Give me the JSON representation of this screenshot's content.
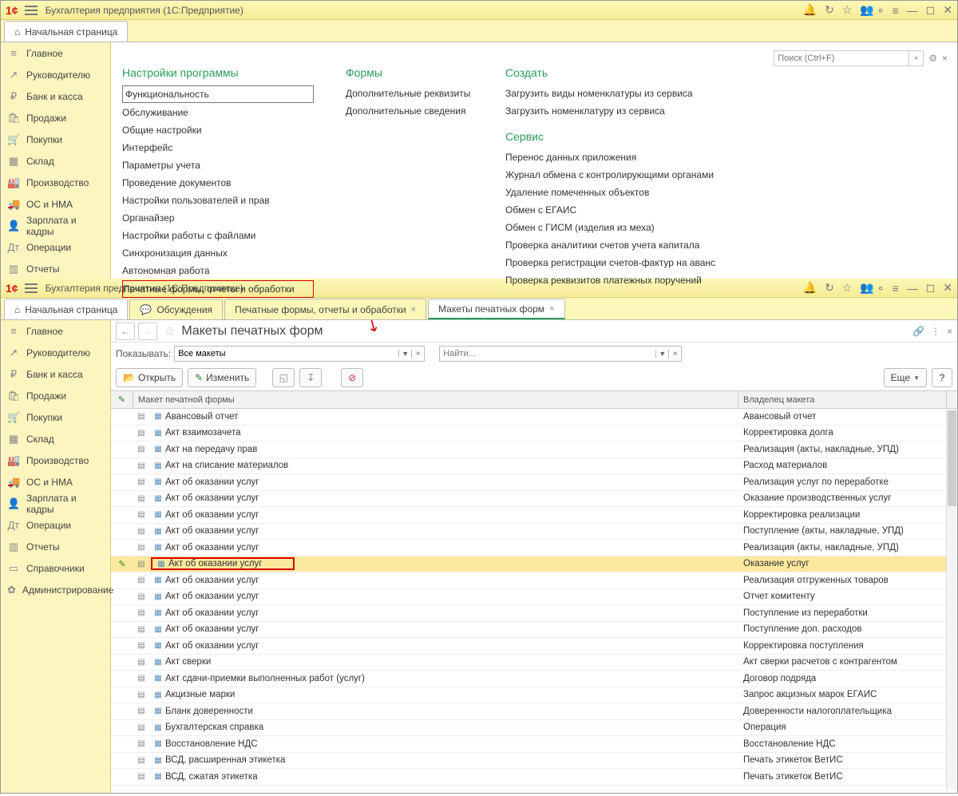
{
  "app": {
    "title": "Бухгалтерия предприятия  (1С:Предприятие)"
  },
  "search": {
    "placeholder": "Поиск (Ctrl+F)"
  },
  "tabs_top": {
    "home": "Начальная страница"
  },
  "sidebar": {
    "items": [
      {
        "label": "Главное",
        "icon": "≡"
      },
      {
        "label": "Руководителю",
        "icon": "↗"
      },
      {
        "label": "Банк и касса",
        "icon": "₽"
      },
      {
        "label": "Продажи",
        "icon": "🛍"
      },
      {
        "label": "Покупки",
        "icon": "🛒"
      },
      {
        "label": "Склад",
        "icon": "▦"
      },
      {
        "label": "Производство",
        "icon": "🏭"
      },
      {
        "label": "ОС и НМА",
        "icon": "🚚"
      },
      {
        "label": "Зарплата и кадры",
        "icon": "👤"
      },
      {
        "label": "Операции",
        "icon": "Дт"
      },
      {
        "label": "Отчеты",
        "icon": "▥"
      }
    ]
  },
  "sidebar2_extra": [
    {
      "label": "Справочники",
      "icon": "▭"
    },
    {
      "label": "Администрирование",
      "icon": "✿"
    }
  ],
  "settings": {
    "col1": {
      "h": "Настройки программы",
      "items": [
        "Функциональность",
        "Обслуживание",
        "Общие настройки",
        "Интерфейс",
        "Параметры учета",
        "Проведение документов",
        "Настройки пользователей и прав",
        "Органайзер",
        "Настройки работы с файлами",
        "Синхронизация данных",
        "Автономная работа",
        "Печатные формы, отчеты и обработки"
      ]
    },
    "col2": {
      "h": "Формы",
      "items": [
        "Дополнительные реквизиты",
        "Дополнительные сведения"
      ]
    },
    "col3": {
      "h": "Создать",
      "items": [
        "Загрузить виды номенклатуры из сервиса",
        "Загрузить номенклатуру из сервиса"
      ]
    },
    "col4": {
      "h": "Сервис",
      "items": [
        "Перенос данных приложения",
        "Журнал обмена с контролирующими органами",
        "Удаление помеченных объектов",
        "Обмен с ЕГАИС",
        "Обмен с ГИСМ (изделия из меха)",
        "Проверка аналитики счетов учета капитала",
        "Проверка регистрации счетов-фактур на аванс",
        "Проверка реквизитов платежных поручений"
      ]
    }
  },
  "tabs2": [
    {
      "label": "Начальная страница",
      "home": true
    },
    {
      "label": "Обсуждения",
      "icon": "💬",
      "close": false
    },
    {
      "label": "Печатные формы, отчеты и обработки",
      "close": true
    },
    {
      "label": "Макеты печатных форм",
      "close": true,
      "active": true
    }
  ],
  "page2": {
    "title": "Макеты печатных форм",
    "filter_lbl": "Показывать:",
    "filter_val": "Все макеты",
    "find_ph": "Найти...",
    "btn_open": "Открыть",
    "btn_edit": "Изменить",
    "btn_more": "Еще",
    "head1": "Макет печатной формы",
    "head2": "Владелец макета"
  },
  "rows": [
    {
      "n": "Авансовый отчет",
      "o": "Авансовый отчет"
    },
    {
      "n": "Акт взаимозачета",
      "o": "Корректировка долга"
    },
    {
      "n": "Акт на передачу прав",
      "o": "Реализация (акты, накладные, УПД)"
    },
    {
      "n": "Акт на списание материалов",
      "o": "Расход материалов"
    },
    {
      "n": "Акт об оказании услуг",
      "o": "Реализация услуг по переработке"
    },
    {
      "n": "Акт об оказании услуг",
      "o": "Оказание производственных услуг"
    },
    {
      "n": "Акт об оказании услуг",
      "o": "Корректировка реализации"
    },
    {
      "n": "Акт об оказании услуг",
      "o": "Поступление (акты, накладные, УПД)"
    },
    {
      "n": "Акт об оказании услуг",
      "o": "Реализация (акты, накладные, УПД)"
    },
    {
      "n": "Акт об оказании услуг",
      "o": "Оказание услуг",
      "sel": true
    },
    {
      "n": "Акт об оказании услуг",
      "o": "Реализация отгруженных товаров"
    },
    {
      "n": "Акт об оказании услуг",
      "o": "Отчет комитенту"
    },
    {
      "n": "Акт об оказании услуг",
      "o": "Поступление из переработки"
    },
    {
      "n": "Акт об оказании услуг",
      "o": "Поступление доп. расходов"
    },
    {
      "n": "Акт об оказании услуг",
      "o": "Корректировка поступления"
    },
    {
      "n": "Акт сверки",
      "o": "Акт сверки расчетов с контрагентом"
    },
    {
      "n": "Акт сдачи-приемки выполненных работ (услуг)",
      "o": "Договор подряда"
    },
    {
      "n": "Акцизные марки",
      "o": "Запрос акцизных марок ЕГАИС"
    },
    {
      "n": "Бланк доверенности",
      "o": "Доверенности налогоплательщика"
    },
    {
      "n": "Бухгалтерская справка",
      "o": "Операция"
    },
    {
      "n": "Восстановление НДС",
      "o": "Восстановление НДС"
    },
    {
      "n": "ВСД, расширенная этикетка",
      "o": "Печать этикеток ВетИС"
    },
    {
      "n": "ВСД, сжатая этикетка",
      "o": "Печать этикеток ВетИС"
    }
  ]
}
